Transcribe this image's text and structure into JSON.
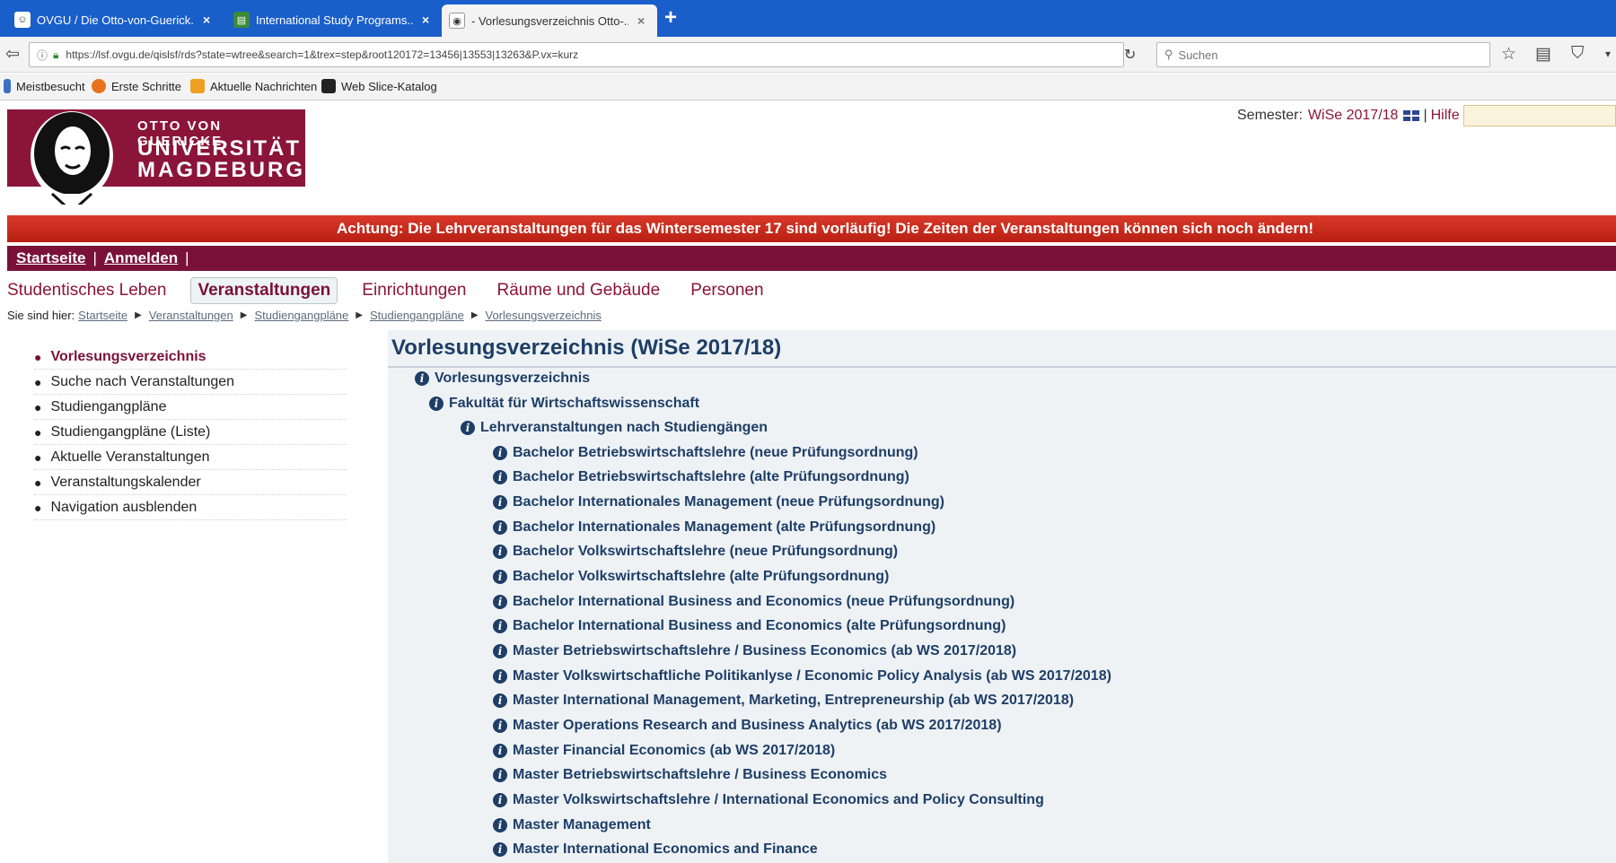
{
  "browser": {
    "tabs": [
      {
        "title": "OVGU / Die Otto-von-Guerick...",
        "close": "×"
      },
      {
        "title": "International Study Programs...",
        "close": "×"
      },
      {
        "title": "- Vorlesungsverzeichnis Otto-...",
        "close": "×"
      }
    ],
    "new_tab": "+",
    "url": "https://lsf.ovgu.de/qislsf/rds?state=wtree&search=1&trex=step&root120172=13456|13553|13263&P.vx=kurz",
    "search_placeholder": "Suchen",
    "bookmarks": [
      "Meistbesucht",
      "Erste Schritte",
      "Aktuelle Nachrichten",
      "Web Slice-Katalog"
    ]
  },
  "header": {
    "logo_line1": "OTTO VON GUERICKE",
    "logo_line2": "UNIVERSITÄT",
    "logo_line3": "MAGDEBURG",
    "semester_label": "Semester:",
    "semester_value": "WiSe 2017/18",
    "separator": "|",
    "help": "Hilfe"
  },
  "alert": "Achtung: Die Lehrveranstaltungen für das Wintersemester 17 sind vorläufig! Die Zeiten der Veranstaltungen können sich noch ändern!",
  "top_nav": {
    "home": "Startseite",
    "login": "Anmelden",
    "sep": "|"
  },
  "main_tabs": [
    "Studentisches Leben",
    "Veranstaltungen",
    "Einrichtungen",
    "Räume und Gebäude",
    "Personen"
  ],
  "breadcrumb": {
    "prefix": "Sie sind hier:",
    "items": [
      "Startseite",
      "Veranstaltungen",
      "Studiengangpläne",
      "Studiengangpläne",
      "Vorlesungsverzeichnis"
    ]
  },
  "sidebar": [
    "Vorlesungsverzeichnis",
    "Suche nach Veranstaltungen",
    "Studiengangpläne",
    "Studiengangpläne (Liste)",
    "Aktuelle Veranstaltungen",
    "Veranstaltungskalender",
    "Navigation ausblenden"
  ],
  "content": {
    "title": "Vorlesungsverzeichnis (WiSe 2017/18)",
    "tree": [
      "Vorlesungsverzeichnis",
      "Fakultät für Wirtschaftswissenschaft",
      "Lehrveranstaltungen nach Studiengängen",
      "Bachelor Betriebswirtschaftslehre (neue Prüfungsordnung)",
      "Bachelor Betriebswirtschaftslehre (alte Prüfungsordnung)",
      "Bachelor Internationales Management (neue Prüfungsordnung)",
      "Bachelor Internationales Management (alte Prüfungsordnung)",
      "Bachelor Volkswirtschaftslehre (neue Prüfungsordnung)",
      "Bachelor Volkswirtschaftslehre (alte Prüfungsordnung)",
      "Bachelor International Business and Economics (neue Prüfungsordnung)",
      "Bachelor International Business and Economics (alte Prüfungsordnung)",
      "Master Betriebswirtschaftslehre / Business Economics (ab WS 2017/2018)",
      "Master Volkswirtschaftliche Politikanlyse / Economic Policy Analysis (ab WS 2017/2018)",
      "Master International Management, Marketing, Entrepreneurship (ab WS 2017/2018)",
      "Master Operations Research and Business Analytics (ab WS 2017/2018)",
      "Master Financial Economics (ab WS 2017/2018)",
      "Master Betriebswirtschaftslehre / Business Economics",
      "Master Volkswirtschaftslehre / International Economics and Policy Consulting",
      "Master Management",
      "Master International Economics and Finance"
    ]
  },
  "colors": {
    "brand": "#8b1538",
    "nav": "#7a1237",
    "alert": "#c82a1c",
    "link": "#1e3e66",
    "content_bg": "#eef2f5"
  }
}
